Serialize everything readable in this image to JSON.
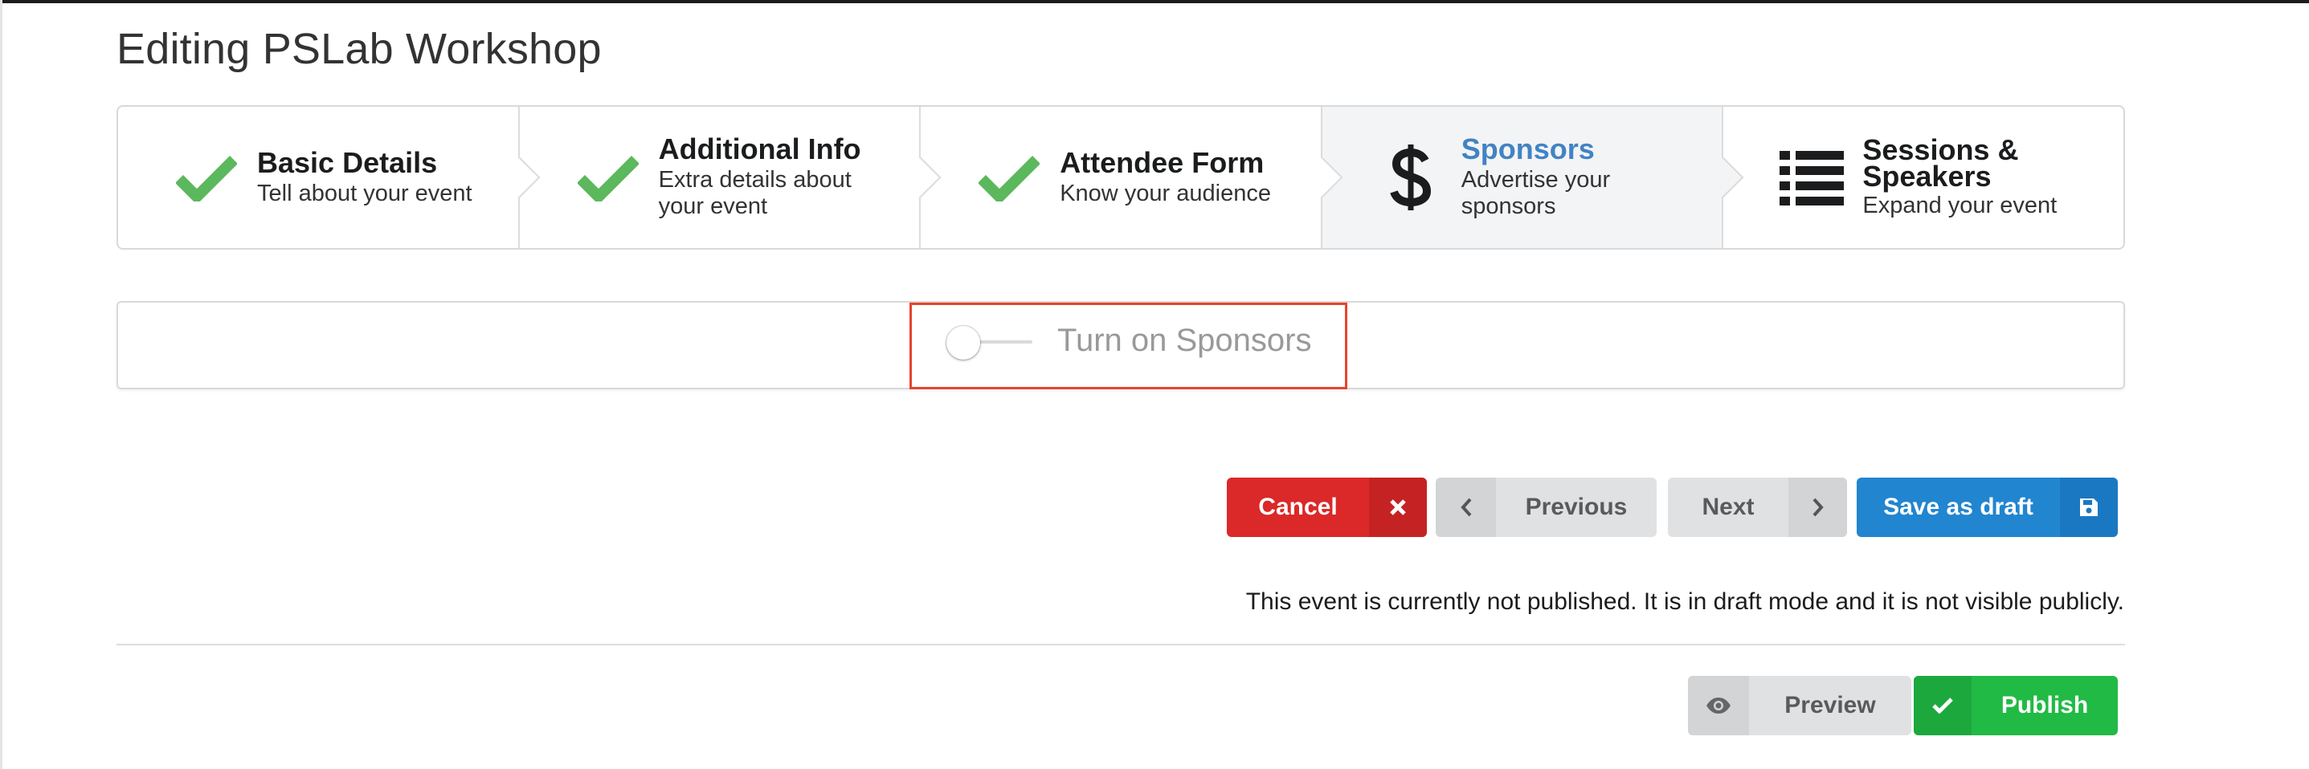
{
  "page": {
    "title": "Editing PSLab Workshop"
  },
  "steps": [
    {
      "title": "Basic Details",
      "desc": "Tell about your event",
      "icon": "check-icon",
      "state": "completed"
    },
    {
      "title": "Additional Info",
      "desc": "Extra details about your event",
      "icon": "check-icon",
      "state": "completed"
    },
    {
      "title": "Attendee Form",
      "desc": "Know your audience",
      "icon": "check-icon",
      "state": "completed"
    },
    {
      "title": "Sponsors",
      "desc": "Advertise your sponsors",
      "icon": "dollar-icon",
      "state": "active"
    },
    {
      "title": "Sessions & Speakers",
      "desc": "Expand your event",
      "icon": "list-icon",
      "state": "pending"
    }
  ],
  "sponsors_toggle": {
    "label": "Turn on Sponsors",
    "checked": false
  },
  "actions": {
    "cancel": "Cancel",
    "previous": "Previous",
    "next": "Next",
    "save_draft": "Save as draft"
  },
  "status_note": "This event is currently not published. It is in draft mode and it is not visible publicly.",
  "footer": {
    "preview": "Preview",
    "publish": "Publish"
  },
  "colors": {
    "check": "#5cb85c",
    "active_step_title": "#4183c4",
    "cancel": "#db2828",
    "save_draft": "#2185d0",
    "publish": "#21ba45",
    "highlight": "#e8432a"
  }
}
